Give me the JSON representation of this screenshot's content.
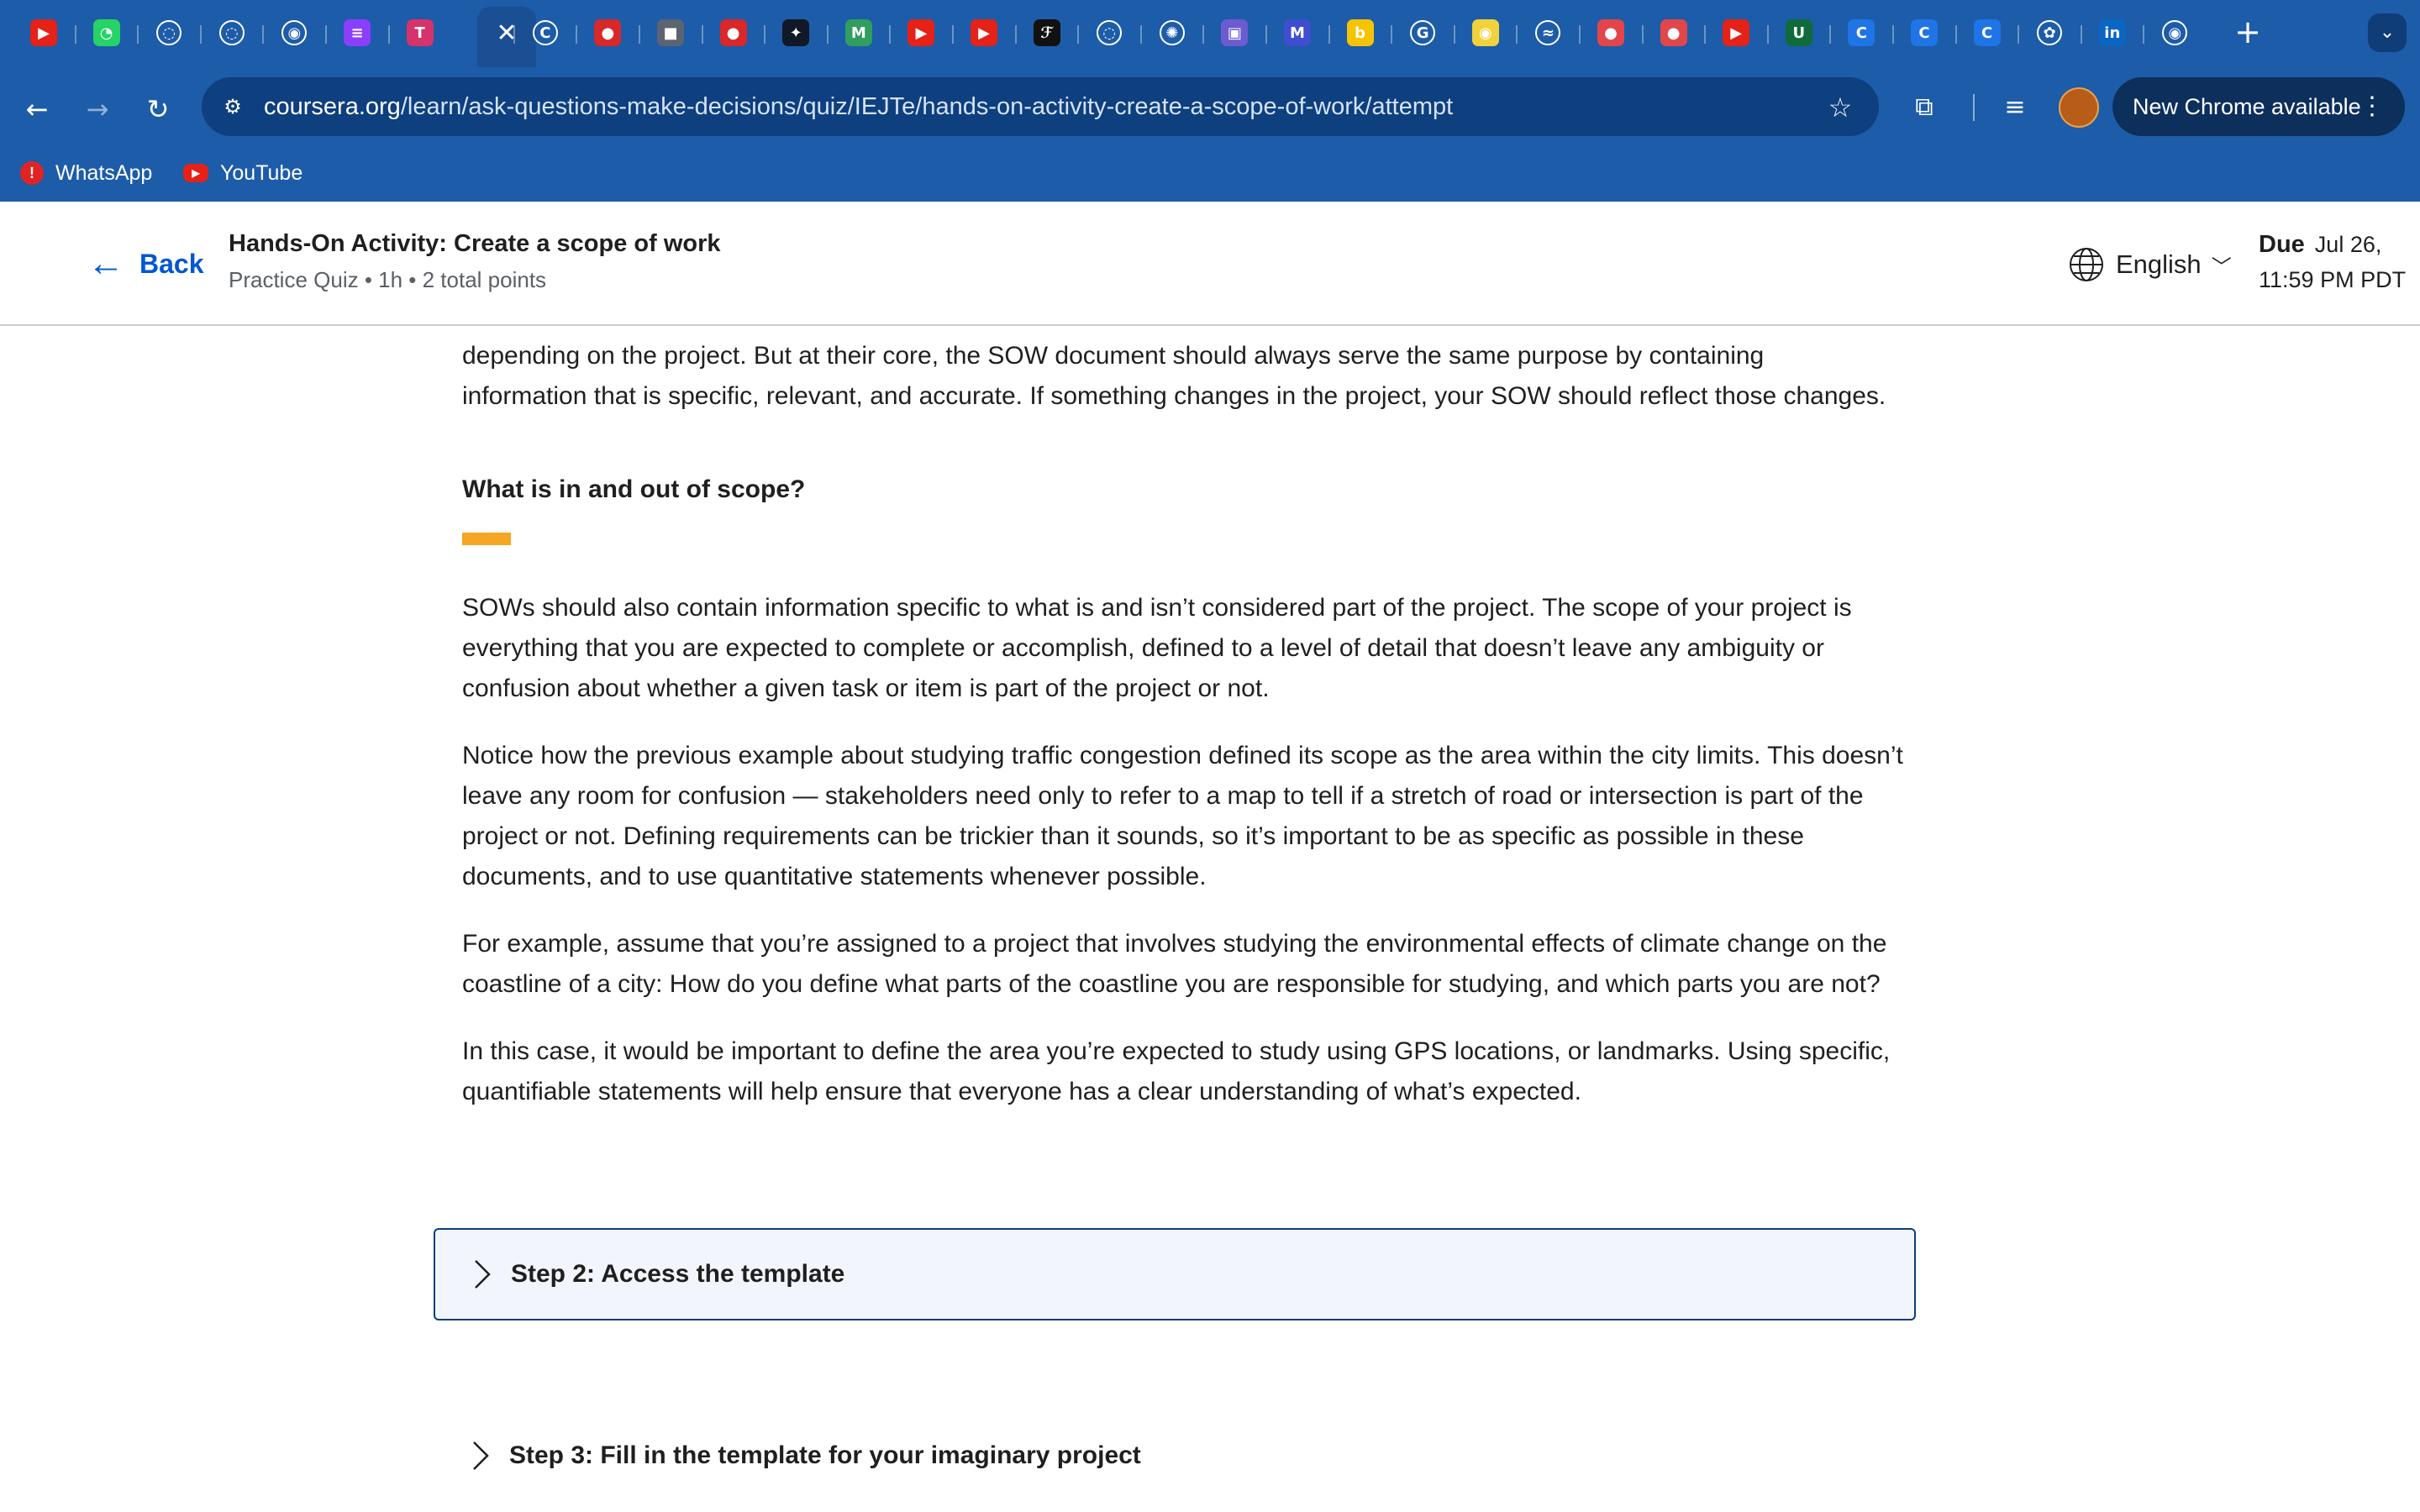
{
  "browser": {
    "address_url_host": "coursera.org",
    "address_url_path": "/learn/ask-questions-make-decisions/quiz/IEJTe/hands-on-activity-create-a-scope-of-work/attempt",
    "new_chrome_label": "New Chrome available",
    "bookmarks": [
      {
        "label": "WhatsApp",
        "icon": "alert-icon"
      },
      {
        "label": "YouTube",
        "icon": "youtube-icon"
      }
    ],
    "tab_favicons": [
      {
        "icon": "youtube-icon",
        "glyph": "▶",
        "color": "#e62117"
      },
      {
        "icon": "whatsapp-icon",
        "glyph": "◔",
        "color": "#25d366"
      },
      {
        "icon": "loading-icon",
        "glyph": "◌",
        "color": "#1d5ca8"
      },
      {
        "icon": "loading-icon",
        "glyph": "◌",
        "color": "#1d5ca8"
      },
      {
        "icon": "github-icon",
        "glyph": "◉",
        "color": "#1d5ca8"
      },
      {
        "icon": "stack-icon",
        "glyph": "≡",
        "color": "#8a3ffc"
      },
      {
        "icon": "brand-icon",
        "glyph": "T",
        "color": "#d6336c"
      },
      {
        "icon": "coursera-icon",
        "glyph": "C",
        "color": "#1d5ca8"
      },
      {
        "icon": "record-icon",
        "glyph": "●",
        "color": "#d8282a"
      },
      {
        "icon": "chip-icon",
        "glyph": "■",
        "color": "#5b6470"
      },
      {
        "icon": "record-icon",
        "glyph": "●",
        "color": "#d8282a"
      },
      {
        "icon": "space-icon",
        "glyph": "✦",
        "color": "#111827"
      },
      {
        "icon": "m-logo-icon",
        "glyph": "M",
        "color": "#2f9e5f"
      },
      {
        "icon": "youtube-icon",
        "glyph": "▶",
        "color": "#e62117"
      },
      {
        "icon": "youtube-icon",
        "glyph": "▶",
        "color": "#e62117"
      },
      {
        "icon": "script-icon",
        "glyph": "ℱ",
        "color": "#111111"
      },
      {
        "icon": "loading-icon",
        "glyph": "◌",
        "color": "#1d5ca8"
      },
      {
        "icon": "aperture-icon",
        "glyph": "✺",
        "color": "#1d5ca8"
      },
      {
        "icon": "camera-icon",
        "glyph": "▣",
        "color": "#6d5bd0"
      },
      {
        "icon": "m-logo-icon",
        "glyph": "M",
        "color": "#3f4ed1"
      },
      {
        "icon": "b-logo-icon",
        "glyph": "b",
        "color": "#f5c400"
      },
      {
        "icon": "google-icon",
        "glyph": "G",
        "color": "#ffffff"
      },
      {
        "icon": "circle-dot-icon",
        "glyph": "◉",
        "color": "#f2d23c"
      },
      {
        "icon": "wave-icon",
        "glyph": "≈",
        "color": "#1d5ca8"
      },
      {
        "icon": "ball-icon",
        "glyph": "●",
        "color": "#e0464a"
      },
      {
        "icon": "ball-icon",
        "glyph": "●",
        "color": "#e0464a"
      },
      {
        "icon": "youtube-icon",
        "glyph": "▶",
        "color": "#e62117"
      },
      {
        "icon": "myunt-icon",
        "glyph": "U",
        "color": "#0f6b3a"
      },
      {
        "icon": "coursera-icon",
        "glyph": "C",
        "color": "#1f74e6"
      },
      {
        "icon": "coursera-icon",
        "glyph": "C",
        "color": "#1f74e6"
      },
      {
        "icon": "coursera-icon",
        "glyph": "C",
        "color": "#1f74e6"
      },
      {
        "icon": "openai-icon",
        "glyph": "✿",
        "color": "#ffffff"
      },
      {
        "icon": "linkedin-icon",
        "glyph": "in",
        "color": "#0a66c2"
      },
      {
        "icon": "github-icon",
        "glyph": "◉",
        "color": "#1d5ca8"
      }
    ]
  },
  "header": {
    "back_label": "Back",
    "title": "Hands-On Activity: Create a scope of work",
    "subtitle": "Practice Quiz • 1h • 2 total points",
    "language": "English",
    "due_label": "Due",
    "due_date": "Jul 26,",
    "due_time": "11:59 PM PDT"
  },
  "content": {
    "intro_lines": [
      "depending on the project. But at their core, the SOW document should always serve the same purpose by containing",
      "information that is specific, relevant, and accurate. If something changes in the project, your SOW should reflect those changes."
    ],
    "section_heading": "What is in and out of scope?",
    "paragraphs": [
      "SOWs should also contain information specific to what is and isn’t considered part of the project. The scope of your project is everything that you are expected to complete or accomplish, defined to a level of detail that doesn’t leave any ambiguity or confusion about whether a given task or item is part of the project or not.",
      "Notice how the previous example about studying traffic congestion defined its scope as the area within the city limits. This doesn’t leave any room for confusion — stakeholders need only to refer to a map to tell if a stretch of road or intersection is part of the project or not.  Defining requirements can be trickier than it sounds, so it’s important to be as specific as possible in these documents, and to use quantitative statements whenever possible.",
      "For example, assume that you’re assigned to a project that involves studying the environmental effects of climate change on the coastline of a city: How do you define what parts of the coastline you are responsible for studying, and which parts you are not?",
      "In this case, it would be important to define the area you’re expected to study using GPS locations, or landmarks. Using specific, quantifiable statements will help ensure that everyone has a clear understanding of what’s expected."
    ]
  },
  "steps": [
    {
      "label": "Step 2: Access the template"
    },
    {
      "label": "Step 3: Fill in the template for your imaginary project"
    }
  ],
  "colors": {
    "browser_chrome": "#1d5ca8",
    "link_blue": "#0056d2",
    "accent_bar": "#f5a623",
    "step_border": "#0a3d7a"
  }
}
